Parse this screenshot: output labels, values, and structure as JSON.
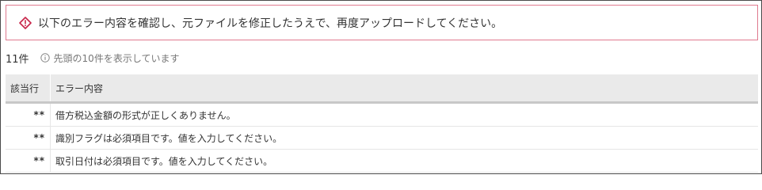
{
  "alert": {
    "icon": "warning-diamond-icon",
    "color": "#c8264a",
    "message": "以下のエラー内容を確認し、元ファイルを修正したうえで、再度アップロードしてください。"
  },
  "summary": {
    "count": "11件",
    "info_icon": "info-circle-icon",
    "info_text": "先頭の10件を表示しています"
  },
  "table": {
    "headers": [
      "該当行",
      "エラー内容"
    ],
    "rows": [
      {
        "row": "**",
        "message": "借方税込金額の形式が正しくありません。"
      },
      {
        "row": "**",
        "message": "識別フラグは必須項目です。値を入力してください。"
      },
      {
        "row": "**",
        "message": "取引日付は必須項目です。値を入力してください。"
      }
    ]
  }
}
